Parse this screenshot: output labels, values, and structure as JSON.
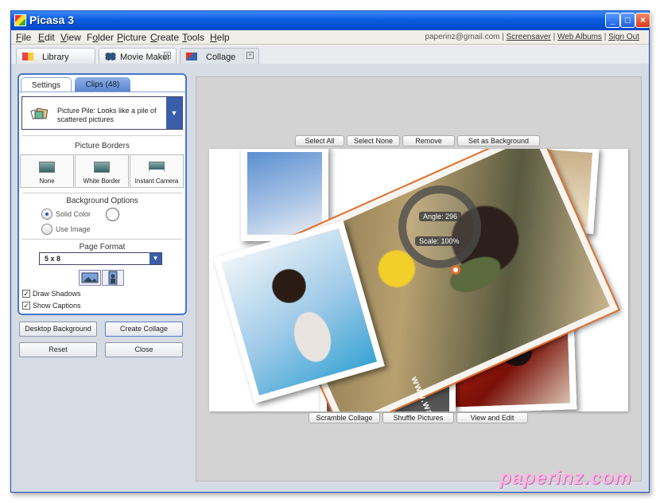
{
  "window": {
    "title": "Picasa 3",
    "controls": [
      "_",
      "□",
      "×"
    ]
  },
  "menu": [
    {
      "label": "File",
      "key": "F",
      "rest": "ile"
    },
    {
      "label": "Edit",
      "key": "E",
      "rest": "dit"
    },
    {
      "label": "View",
      "key": "V",
      "rest": "iew"
    },
    {
      "label": "Folder",
      "key": "o",
      "pre": "F",
      "rest": "lder"
    },
    {
      "label": "Picture",
      "key": "P",
      "rest": "icture"
    },
    {
      "label": "Create",
      "key": "C",
      "rest": "reate"
    },
    {
      "label": "Tools",
      "key": "T",
      "rest": "ools"
    },
    {
      "label": "Help",
      "key": "H",
      "rest": "elp"
    }
  ],
  "account": {
    "email": "paperinz@gmail.com",
    "sep": "|",
    "screensaver": "Screensaver",
    "web_albums": "Web Albums",
    "sign_out": "Sign Out"
  },
  "tabs": [
    {
      "label": "Library"
    },
    {
      "label": "Movie Maker",
      "close": "×"
    },
    {
      "label": "Collage",
      "close": "×"
    }
  ],
  "panel": {
    "tab_settings": "Settings",
    "tab_clips": "Clips (48)",
    "style": "Picture Pile:  Looks like a pile of scattered pictures",
    "dropdown_glyph": "▼",
    "borders_title": "Picture Borders",
    "borders": [
      "None",
      "White Border",
      "Instant Camera"
    ],
    "bg_title": "Background Options",
    "solid_color": "Solid Color",
    "use_image": "Use Image",
    "format_title": "Page Format",
    "format_value": "5 x 8",
    "draw_shadows": "Draw Shadows",
    "show_captions": "Show Captions",
    "check": "✓"
  },
  "buttons": {
    "desktop_bg": "Desktop Background",
    "create": "Create Collage",
    "reset": "Reset",
    "close": "Close"
  },
  "toolbar_top": {
    "select_all": "Select All",
    "select_none": "Select None",
    "remove": "Remove",
    "set_bg": "Set as Background"
  },
  "toolbar_bottom": {
    "scramble": "Scramble Collage",
    "shuffle": "Shuffle Pictures",
    "view_edit": "View and Edit"
  },
  "overlay": {
    "angle": "Angle: 296",
    "scale": "Scale: 100%"
  },
  "photo_caption": "www.warnermusic.com.tw",
  "watermark": "paperinz.com",
  "colors": {
    "accent": "#3a5fa8",
    "titlebar": "#0a5ce0",
    "selection": "#e07030"
  }
}
